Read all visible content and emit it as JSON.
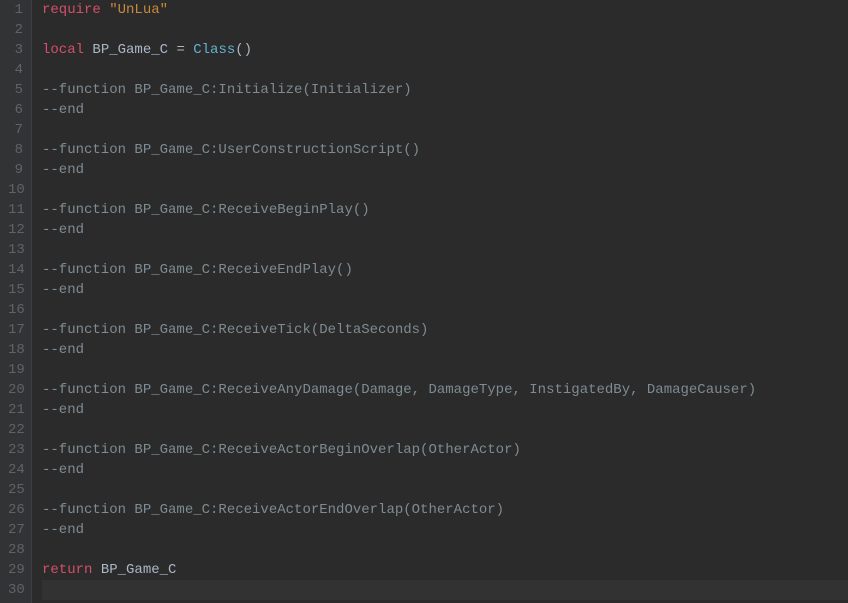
{
  "editor": {
    "lines": [
      {
        "n": "1",
        "tokens": [
          {
            "cls": "kw-require",
            "t": "require"
          },
          {
            "cls": "ident",
            "t": " "
          },
          {
            "cls": "str",
            "t": "\"UnLua\""
          }
        ]
      },
      {
        "n": "2",
        "tokens": []
      },
      {
        "n": "3",
        "tokens": [
          {
            "cls": "kw-local",
            "t": "local"
          },
          {
            "cls": "ident",
            "t": " BP_Game_C "
          },
          {
            "cls": "op",
            "t": "= "
          },
          {
            "cls": "class-call",
            "t": "Class"
          },
          {
            "cls": "ident",
            "t": "()"
          }
        ]
      },
      {
        "n": "4",
        "tokens": []
      },
      {
        "n": "5",
        "tokens": [
          {
            "cls": "comment",
            "t": "--function BP_Game_C:Initialize(Initializer)"
          }
        ]
      },
      {
        "n": "6",
        "tokens": [
          {
            "cls": "comment",
            "t": "--end"
          }
        ]
      },
      {
        "n": "7",
        "tokens": []
      },
      {
        "n": "8",
        "tokens": [
          {
            "cls": "comment",
            "t": "--function BP_Game_C:UserConstructionScript()"
          }
        ]
      },
      {
        "n": "9",
        "tokens": [
          {
            "cls": "comment",
            "t": "--end"
          }
        ]
      },
      {
        "n": "10",
        "tokens": []
      },
      {
        "n": "11",
        "tokens": [
          {
            "cls": "comment",
            "t": "--function BP_Game_C:ReceiveBeginPlay()"
          }
        ]
      },
      {
        "n": "12",
        "tokens": [
          {
            "cls": "comment",
            "t": "--end"
          }
        ]
      },
      {
        "n": "13",
        "tokens": []
      },
      {
        "n": "14",
        "tokens": [
          {
            "cls": "comment",
            "t": "--function BP_Game_C:ReceiveEndPlay()"
          }
        ]
      },
      {
        "n": "15",
        "tokens": [
          {
            "cls": "comment",
            "t": "--end"
          }
        ]
      },
      {
        "n": "16",
        "tokens": []
      },
      {
        "n": "17",
        "tokens": [
          {
            "cls": "comment",
            "t": "--function BP_Game_C:ReceiveTick(DeltaSeconds)"
          }
        ]
      },
      {
        "n": "18",
        "tokens": [
          {
            "cls": "comment",
            "t": "--end"
          }
        ]
      },
      {
        "n": "19",
        "tokens": []
      },
      {
        "n": "20",
        "tokens": [
          {
            "cls": "comment",
            "t": "--function BP_Game_C:ReceiveAnyDamage(Damage, DamageType, InstigatedBy, DamageCauser)"
          }
        ]
      },
      {
        "n": "21",
        "tokens": [
          {
            "cls": "comment",
            "t": "--end"
          }
        ]
      },
      {
        "n": "22",
        "tokens": []
      },
      {
        "n": "23",
        "tokens": [
          {
            "cls": "comment",
            "t": "--function BP_Game_C:ReceiveActorBeginOverlap(OtherActor)"
          }
        ]
      },
      {
        "n": "24",
        "tokens": [
          {
            "cls": "comment",
            "t": "--end"
          }
        ]
      },
      {
        "n": "25",
        "tokens": []
      },
      {
        "n": "26",
        "tokens": [
          {
            "cls": "comment",
            "t": "--function BP_Game_C:ReceiveActorEndOverlap(OtherActor)"
          }
        ]
      },
      {
        "n": "27",
        "tokens": [
          {
            "cls": "comment",
            "t": "--end"
          }
        ]
      },
      {
        "n": "28",
        "tokens": []
      },
      {
        "n": "29",
        "tokens": [
          {
            "cls": "kw-return",
            "t": "return"
          },
          {
            "cls": "ident",
            "t": " BP_Game_C"
          }
        ]
      },
      {
        "n": "30",
        "tokens": [],
        "current": true
      }
    ]
  }
}
